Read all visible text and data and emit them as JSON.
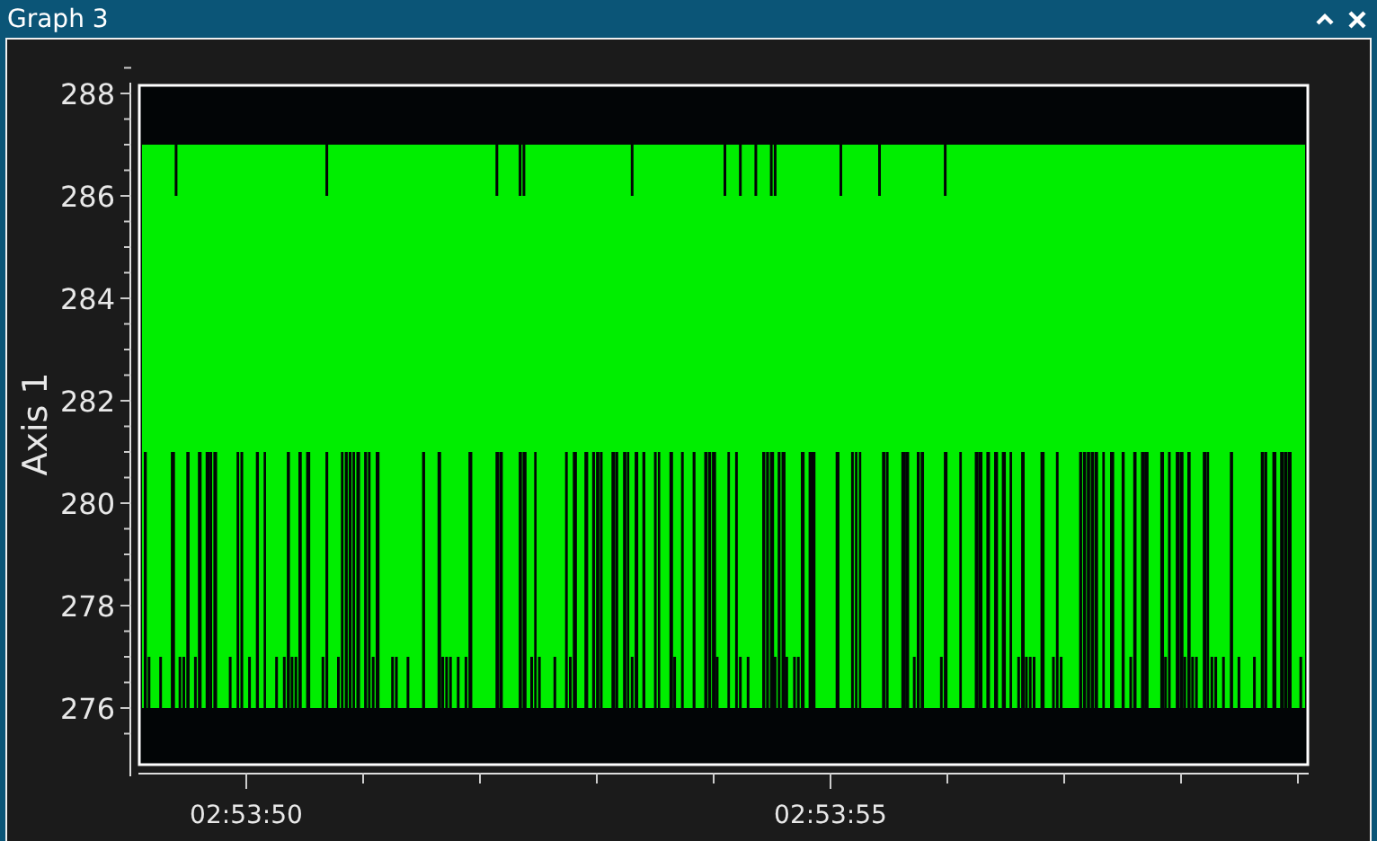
{
  "window": {
    "title": "Graph 3"
  },
  "plot": {
    "ylabel": "Axis 1",
    "yticks": [
      "288",
      "286",
      "284",
      "282",
      "280",
      "278",
      "276"
    ],
    "xticks": [
      "02:53:50",
      "02:53:55"
    ]
  }
}
